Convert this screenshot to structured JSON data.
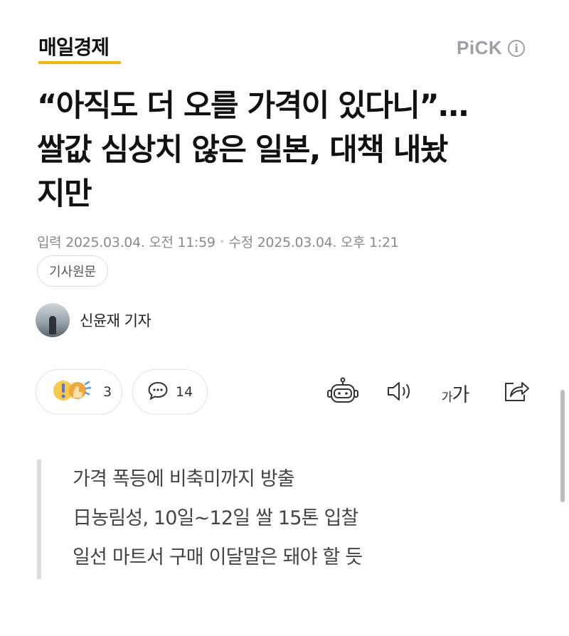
{
  "header": {
    "publisher": "매일경제",
    "pick_label": "PiCK",
    "info_glyph": "i",
    "brand_underline_color": "#f2b705"
  },
  "article": {
    "title_lines": [
      "“아직도 더 오를 가격이 있다니”…",
      "쌀값 심상치 않은 일본, 대책 내놨",
      "지만"
    ],
    "published": "입력 2025.03.04. 오전 11:59",
    "separator": "•",
    "modified": "수정 2025.03.04. 오후 1:21",
    "original_button": "기사원문",
    "reporter": "신윤재 기자"
  },
  "actions": {
    "reaction_count": "3",
    "comment_count": "14",
    "font_small": "가",
    "font_large": "가",
    "icons": [
      "reaction-icon",
      "comment-icon",
      "robot-icon",
      "speaker-icon",
      "font-size-icon",
      "share-icon"
    ]
  },
  "summary": {
    "lines": [
      "가격 폭등에 비축미까지 방출",
      "日농림성, 10일~12일 쌀 15톤 입찰",
      "일선 마트서 구매 이달말은 돼야 할 듯"
    ]
  }
}
